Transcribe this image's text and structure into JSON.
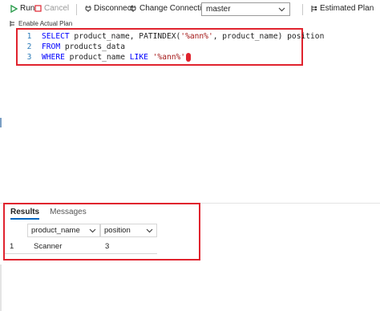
{
  "toolbar": {
    "run_label": "Run",
    "cancel_label": "Cancel",
    "disconnect_label": "Disconnect",
    "change_connection_label": "Change Connection",
    "database_value": "master",
    "estimated_plan_label": "Estimated Plan"
  },
  "plan_toggle_label": "Enable Actual Plan",
  "editor": {
    "lines": [
      {
        "num": "1",
        "kw1": "SELECT",
        "text1": " product_name, ",
        "fn": "PATINDEX",
        "text2": "(",
        "str": "'%ann%'",
        "text3": ", product_name) position"
      },
      {
        "num": "2",
        "kw1": "FROM",
        "text1": " products_data"
      },
      {
        "num": "3",
        "kw1": "WHERE",
        "text1": " product_name ",
        "kw2": "LIKE",
        "text2": " ",
        "str": "'%ann%'"
      }
    ]
  },
  "results": {
    "tabs": [
      "Results",
      "Messages"
    ],
    "columns": [
      "product_name",
      "position"
    ],
    "rows": [
      {
        "num": "1",
        "cells": [
          "Scanner",
          "3"
        ]
      }
    ]
  },
  "colors": {
    "highlight_border": "#e0232e",
    "keyword": "#0000ff",
    "string": "#a31515",
    "line_number": "#2b7bb9",
    "run_icon": "#2e9e4f"
  }
}
